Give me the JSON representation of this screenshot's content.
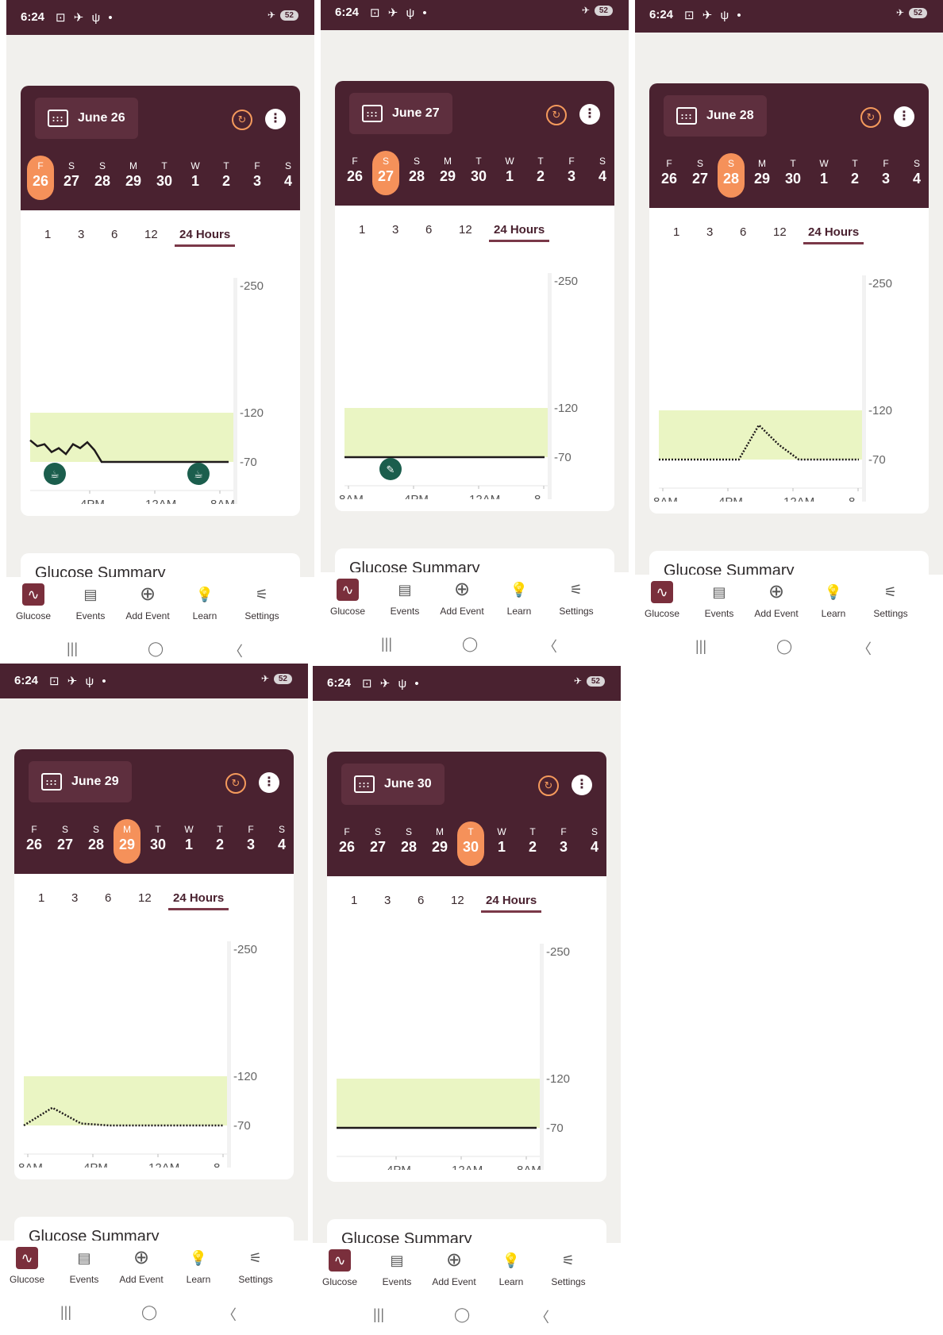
{
  "status_bar": {
    "time": "6:24",
    "battery": "52"
  },
  "tabs": [
    "1",
    "3",
    "6",
    "12",
    "24 Hours"
  ],
  "y_ticks": [
    "250",
    "120",
    "70"
  ],
  "summary_title": "Glucose Summary",
  "nav": [
    "Glucose",
    "Events",
    "Add Event",
    "Learn",
    "Settings"
  ],
  "weekdays": [
    "F",
    "S",
    "S",
    "M",
    "T",
    "W",
    "T",
    "F",
    "S"
  ],
  "daynums": [
    "26",
    "27",
    "28",
    "29",
    "30",
    "1",
    "2",
    "3",
    "4"
  ],
  "colors": {
    "header": "#4a2230",
    "accent": "#f5915a",
    "range_band": "#eaf5c3"
  },
  "screens": [
    {
      "date": "June 26",
      "selected_index": 0,
      "x_labels": [
        "4PM",
        "12AM",
        "8AM"
      ]
    },
    {
      "date": "June 27",
      "selected_index": 1,
      "x_labels": [
        "8AM",
        "4PM",
        "12AM",
        "8"
      ]
    },
    {
      "date": "June 28",
      "selected_index": 2,
      "x_labels": [
        "8AM",
        "4PM",
        "12AM",
        "8"
      ]
    },
    {
      "date": "June 29",
      "selected_index": 3,
      "x_labels": [
        "8AM",
        "4PM",
        "12AM",
        "8"
      ]
    },
    {
      "date": "June 30",
      "selected_index": 4,
      "x_labels": [
        "4PM",
        "12AM",
        "8AM"
      ]
    }
  ],
  "chart_data": [
    {
      "type": "line",
      "title": "June 26",
      "y_ticks": [
        250,
        120,
        70
      ],
      "target_range": [
        70,
        120
      ],
      "x_ticks": [
        "4PM",
        "12AM",
        "8AM"
      ],
      "series": [
        {
          "values": [
            92,
            86,
            88,
            80,
            84,
            78,
            88,
            84,
            90,
            82,
            70,
            70,
            70,
            70,
            70,
            70
          ]
        }
      ],
      "event_markers": [
        "meal",
        "meal +3"
      ]
    },
    {
      "type": "line",
      "title": "June 27",
      "y_ticks": [
        250,
        120,
        70
      ],
      "target_range": [
        70,
        120
      ],
      "x_ticks": [
        "8AM",
        "4PM",
        "12AM",
        "8"
      ],
      "series": [
        {
          "values": [
            70,
            70,
            70,
            70,
            70,
            70,
            70
          ]
        }
      ],
      "event_markers": [
        "edit"
      ]
    },
    {
      "type": "line",
      "title": "June 28",
      "y_ticks": [
        250,
        120,
        70
      ],
      "target_range": [
        70,
        120
      ],
      "x_ticks": [
        "8AM",
        "4PM",
        "12AM",
        "8"
      ],
      "series": [
        {
          "values": [
            70,
            70,
            70,
            70,
            70,
            105,
            85,
            70,
            70,
            70,
            70
          ]
        }
      ]
    },
    {
      "type": "line",
      "title": "June 29",
      "y_ticks": [
        250,
        120,
        70
      ],
      "target_range": [
        70,
        120
      ],
      "x_ticks": [
        "8AM",
        "4PM",
        "12AM",
        "8"
      ],
      "series": [
        {
          "values": [
            70,
            88,
            72,
            70,
            70,
            70,
            70,
            70
          ]
        }
      ]
    },
    {
      "type": "line",
      "title": "June 30",
      "y_ticks": [
        250,
        120,
        70
      ],
      "target_range": [
        70,
        120
      ],
      "x_ticks": [
        "4PM",
        "12AM",
        "8AM"
      ],
      "series": [
        {
          "values": [
            70,
            70,
            70,
            70,
            70,
            70
          ]
        }
      ]
    }
  ]
}
